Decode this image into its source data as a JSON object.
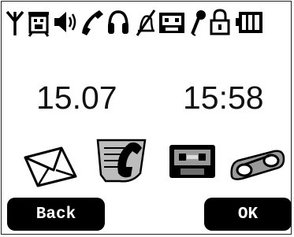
{
  "status_icons": [
    "signal-antenna-icon",
    "alarm-clock-icon",
    "speaker-icon",
    "phone-handset-icon",
    "headset-icon",
    "muted-bell-icon",
    "cassette-icon",
    "microphone-icon",
    "padlock-icon",
    "battery-icon"
  ],
  "clock": {
    "date": "15.07",
    "time": "15:58"
  },
  "apps": [
    "envelope-icon",
    "call-note-icon",
    "tape-icon",
    "voicemail-icon"
  ],
  "softkeys": {
    "left_label": "Back",
    "right_label": "OK"
  },
  "colors": {
    "foreground": "#000000",
    "background": "#ffffff"
  }
}
